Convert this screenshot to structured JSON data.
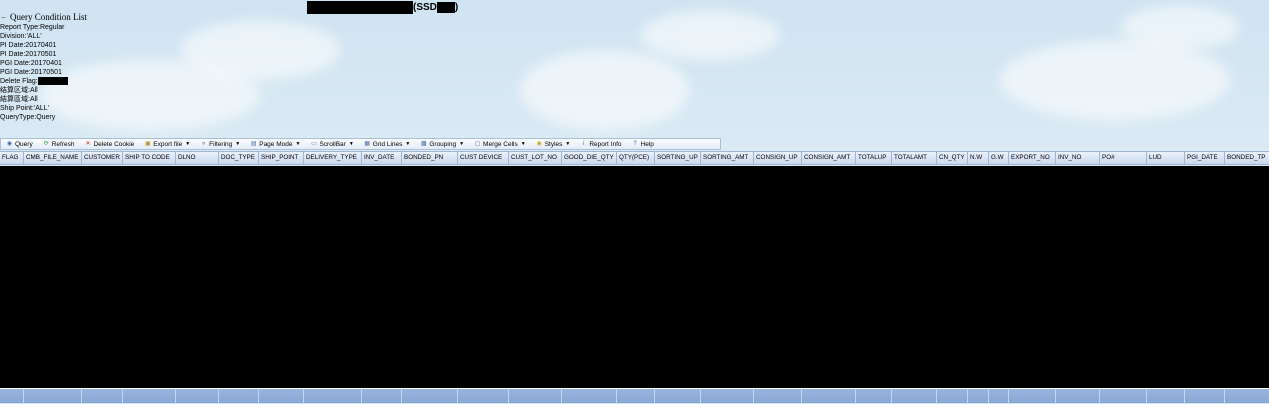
{
  "page_title": {
    "suffix_open": "(SSD",
    "suffix_close": ")"
  },
  "conditions": {
    "header": "Query Condition List",
    "lines": [
      {
        "label": "Report Type:",
        "value": "Regular"
      },
      {
        "label": "Division:",
        "value": "'ALL'"
      },
      {
        "label": "PI Date:",
        "value": "20170401"
      },
      {
        "label": "PI Date:",
        "value": "20170501"
      },
      {
        "label": "PGI Date:",
        "value": "20170401"
      },
      {
        "label": "PGI Date:",
        "value": "20170501"
      },
      {
        "label": "Delete Flag:",
        "value": ""
      },
      {
        "label": "结算区域:",
        "value": "All"
      },
      {
        "label": "結算區域:",
        "value": "All"
      },
      {
        "label": "Ship Point:",
        "value": "'ALL'"
      },
      {
        "label": "QueryType:",
        "value": "Query"
      }
    ]
  },
  "toolbar": {
    "buttons": [
      {
        "label": "Query",
        "icon": "binoculars-icon",
        "color": "#3a6fb0",
        "dropdown": false
      },
      {
        "label": "Refresh",
        "icon": "refresh-icon",
        "color": "#2e9b3a",
        "dropdown": false
      },
      {
        "label": "Delete Cookie",
        "icon": "delete-x-icon",
        "color": "#d02020",
        "dropdown": false
      },
      {
        "label": "Export file",
        "icon": "export-icon",
        "color": "#c08a20",
        "dropdown": true
      },
      {
        "label": "Filtering",
        "icon": "filter-icon",
        "color": "#555555",
        "dropdown": true
      },
      {
        "label": "Page Mode",
        "icon": "page-icon",
        "color": "#4a6fa5",
        "dropdown": true
      },
      {
        "label": "ScrollBar",
        "icon": "scrollbar-icon",
        "color": "#4a6fa5",
        "dropdown": true
      },
      {
        "label": "Grid Lines",
        "icon": "grid-icon",
        "color": "#4a6fa5",
        "dropdown": true
      },
      {
        "label": "Grouping",
        "icon": "grouping-icon",
        "color": "#4a6fa5",
        "dropdown": true
      },
      {
        "label": "Merge Cells",
        "icon": "merge-icon",
        "color": "#4a6fa5",
        "dropdown": true
      },
      {
        "label": "Styles",
        "icon": "palette-icon",
        "color": "#d0a020",
        "dropdown": true
      },
      {
        "label": "Report Info",
        "icon": "info-icon",
        "color": "#2f5fb0",
        "dropdown": false
      },
      {
        "label": "Help",
        "icon": "help-icon",
        "color": "#2f5fb0",
        "dropdown": false
      }
    ]
  },
  "grid": {
    "columns": [
      "FLAG",
      "CMB_FILE_NAME",
      "CUSTOMER",
      "SHIP TO CODE",
      "DLNO",
      "DOC_TYPE",
      "SHIP_POINT",
      "DELIVERY_TYPE",
      "INV_DATE",
      "BONDED_PN",
      "CUST DEVICE",
      "CUST_LOT_NO",
      "GOOD_DIE_QTY",
      "QTY(PCE)",
      "SORTING_UP",
      "SORTING_AMT",
      "CONSIGN_UP",
      "CONSIGN_AMT",
      "TOTALUP",
      "TOTALAMT",
      "CN_QTY",
      "N.W",
      "G.W",
      "EXPORT_NO",
      "INV_NO",
      "PO#",
      "LUD",
      "PGI_DATE",
      "BONDED_TP"
    ]
  },
  "colors": {
    "header_bg": "#c9d9ee",
    "footer_bg": "#8eabd8",
    "body_bg": "#000000"
  }
}
